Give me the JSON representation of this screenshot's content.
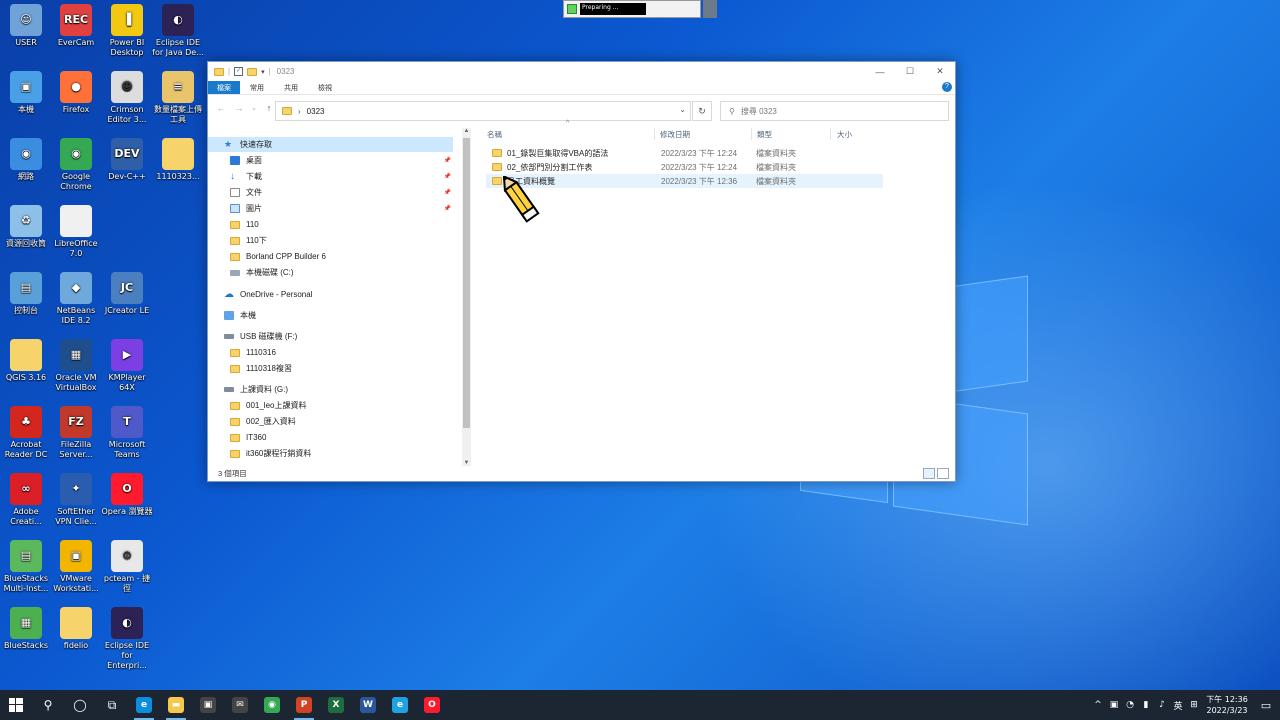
{
  "desktop": {
    "icons": [
      {
        "label": "USER",
        "color": "#6fa3d8",
        "glyph": "☺"
      },
      {
        "label": "EverCam",
        "color": "#e04040",
        "glyph": "REC"
      },
      {
        "label": "Power BI Desktop",
        "color": "#f2c811",
        "glyph": "▐"
      },
      {
        "label": "Eclipse IDE for Java De...",
        "color": "#2c2255",
        "glyph": "◐"
      },
      {
        "label": "本機",
        "color": "#4aa0e6",
        "glyph": "▣"
      },
      {
        "label": "Firefox",
        "color": "#ff7139",
        "glyph": "●"
      },
      {
        "label": "Crimson Editor 3...",
        "color": "#dddddd",
        "glyph": "☻"
      },
      {
        "label": "數量檔案上傳工具",
        "color": "#e8c46a",
        "glyph": "≡"
      },
      {
        "label": "網路",
        "color": "#3b8de0",
        "glyph": "◉"
      },
      {
        "label": "Google Chrome",
        "color": "#34a853",
        "glyph": "◉"
      },
      {
        "label": "Dev-C++",
        "color": "#2f5fa8",
        "glyph": "DEV"
      },
      {
        "label": "1110323...",
        "color": "#f6d36b",
        "glyph": ""
      },
      {
        "label": "資源回收筒",
        "color": "#8cc0e8",
        "glyph": "♻"
      },
      {
        "label": "LibreOffice 7.0",
        "color": "#f0f0f0",
        "glyph": ""
      },
      {
        "label": "控制台",
        "color": "#5aa0d8",
        "glyph": "▤"
      },
      {
        "label": "NetBeans IDE 8.2",
        "color": "#6fa8dc",
        "glyph": "◆"
      },
      {
        "label": "JCreator LE",
        "color": "#4a7fc0",
        "glyph": "JC"
      },
      {
        "label": "QGIS 3.16",
        "color": "#f6d36b",
        "glyph": ""
      },
      {
        "label": "Oracle VM VirtualBox",
        "color": "#1f4e8c",
        "glyph": "▦"
      },
      {
        "label": "KMPlayer 64X",
        "color": "#7b3fe4",
        "glyph": "▶"
      },
      {
        "label": "Acrobat Reader DC",
        "color": "#d3261f",
        "glyph": "♣"
      },
      {
        "label": "FileZilla Server...",
        "color": "#c0392b",
        "glyph": "FZ"
      },
      {
        "label": "Microsoft Teams",
        "color": "#5059c9",
        "glyph": "T"
      },
      {
        "label": "Adobe Creati...",
        "color": "#da1f26",
        "glyph": "∞"
      },
      {
        "label": "SoftEther VPN Clie...",
        "color": "#2a5db0",
        "glyph": "✦"
      },
      {
        "label": "Opera 瀏覽器",
        "color": "#ff1b2d",
        "glyph": "O"
      },
      {
        "label": "BlueStacks Multi-Inst...",
        "color": "#5cb85c",
        "glyph": "▤"
      },
      {
        "label": "VMware Workstati...",
        "color": "#f2b600",
        "glyph": "▣"
      },
      {
        "label": "pcteam - 捷徑",
        "color": "#e8e8e8",
        "glyph": "⚙"
      },
      {
        "label": "BlueStacks",
        "color": "#4caf50",
        "glyph": "▦"
      },
      {
        "label": "fidelio",
        "color": "#f6d36b",
        "glyph": ""
      },
      {
        "label": "Eclipse IDE for Enterpri...",
        "color": "#2c2255",
        "glyph": "◐"
      }
    ]
  },
  "recorder": {
    "status": "Preparing ..."
  },
  "explorer": {
    "title": "0323",
    "ribbon_tabs": [
      "檔案",
      "常用",
      "共用",
      "檢視"
    ],
    "address": "0323",
    "search_placeholder": "搜尋 0323",
    "nav": [
      {
        "label": "快速存取",
        "icon": "star",
        "indent": 0,
        "selected": true,
        "pin": false
      },
      {
        "label": "桌面",
        "icon": "desktop",
        "indent": 1,
        "pin": true
      },
      {
        "label": "下載",
        "icon": "download",
        "indent": 1,
        "pin": true
      },
      {
        "label": "文件",
        "icon": "document",
        "indent": 1,
        "pin": true
      },
      {
        "label": "圖片",
        "icon": "picture",
        "indent": 1,
        "pin": true
      },
      {
        "label": "110",
        "icon": "folder",
        "indent": 1,
        "pin": false
      },
      {
        "label": "110下",
        "icon": "folder",
        "indent": 1,
        "pin": false
      },
      {
        "label": "Borland CPP Builder 6",
        "icon": "folder",
        "indent": 1,
        "pin": false
      },
      {
        "label": "本機磁碟 (C:)",
        "icon": "drive",
        "indent": 1,
        "pin": false
      },
      {
        "label": "OneDrive - Personal",
        "icon": "cloud",
        "indent": 0,
        "pin": false
      },
      {
        "label": "本機",
        "icon": "pc",
        "indent": 0,
        "pin": false
      },
      {
        "label": "USB 磁碟機 (F:)",
        "icon": "usb",
        "indent": 0,
        "pin": false
      },
      {
        "label": "1110316",
        "icon": "folder",
        "indent": 1,
        "pin": false
      },
      {
        "label": "1110318複習",
        "icon": "folder",
        "indent": 1,
        "pin": false
      },
      {
        "label": "上課資料 (G:)",
        "icon": "usb",
        "indent": 0,
        "pin": false
      },
      {
        "label": "001_leo上課資料",
        "icon": "folder",
        "indent": 1,
        "pin": false
      },
      {
        "label": "002_匯入資料",
        "icon": "folder",
        "indent": 1,
        "pin": false
      },
      {
        "label": "IT360",
        "icon": "folder",
        "indent": 1,
        "pin": false
      },
      {
        "label": "it360課程行銷資料",
        "icon": "folder",
        "indent": 1,
        "pin": false
      }
    ],
    "columns": [
      "名稱",
      "修改日期",
      "類型",
      "大小"
    ],
    "files": [
      {
        "name": "01_錄製巨集取得VBA的語法",
        "date": "2022/3/23 下午 12:24",
        "type": "檔案資料夾"
      },
      {
        "name": "02_依部門別分割工作表",
        "date": "2022/3/23 下午 12:24",
        "type": "檔案資料夾"
      },
      {
        "name": "員工資料概覽",
        "date": "2022/3/23 下午 12:36",
        "type": "檔案資料夾"
      }
    ],
    "status": "3 個項目"
  },
  "taskbar": {
    "apps": [
      {
        "name": "edge",
        "color": "#0c8ee0",
        "glyph": "e",
        "open": true
      },
      {
        "name": "explorer",
        "color": "#f6c94d",
        "glyph": "▬",
        "open": true
      },
      {
        "name": "store",
        "color": "#444444",
        "glyph": "▣",
        "open": false
      },
      {
        "name": "mail",
        "color": "#444444",
        "glyph": "✉",
        "open": false
      },
      {
        "name": "chrome",
        "color": "#34a853",
        "glyph": "◉",
        "open": false
      },
      {
        "name": "powerpoint",
        "color": "#d04423",
        "glyph": "P",
        "open": true
      },
      {
        "name": "excel",
        "color": "#1d6f42",
        "glyph": "X",
        "open": false
      },
      {
        "name": "word",
        "color": "#2b579a",
        "glyph": "W",
        "open": false
      },
      {
        "name": "ie",
        "color": "#1ea2e4",
        "glyph": "e",
        "open": false
      },
      {
        "name": "opera",
        "color": "#ff1b2d",
        "glyph": "O",
        "open": false
      }
    ],
    "tray_lang": "英",
    "clock_time": "下午 12:36",
    "clock_date": "2022/3/23"
  }
}
